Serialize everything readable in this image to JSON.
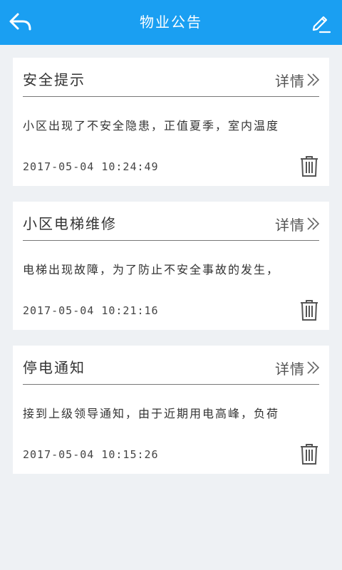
{
  "header": {
    "title": "物业公告",
    "back_icon": "back-arrow-icon",
    "edit_icon": "pencil-edit-icon",
    "background_color": "#1a9ff2"
  },
  "notices": [
    {
      "title": "安全提示",
      "detail_label": "详情",
      "summary": "小区出现了不安全隐患，正值夏季，室内温度",
      "time": "2017-05-04 10:24:49"
    },
    {
      "title": "小区电梯维修",
      "detail_label": "详情",
      "summary": "电梯出现故障，为了防止不安全事故的发生，",
      "time": "2017-05-04 10:21:16"
    },
    {
      "title": "停电通知",
      "detail_label": "详情",
      "summary": "接到上级领导通知，由于近期用电高峰，负荷",
      "time": "2017-05-04 10:15:26"
    }
  ]
}
